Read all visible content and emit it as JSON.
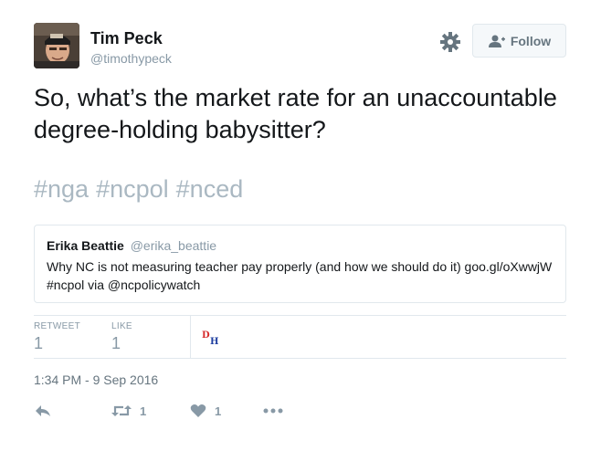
{
  "author": {
    "name": "Tim Peck",
    "handle": "@timothypeck"
  },
  "header": {
    "follow_label": "Follow",
    "settings_icon": "gear-icon",
    "follow_icon": "add-user-icon"
  },
  "tweet": {
    "text": "So, what’s the market rate for an unaccountable degree-holding babysitter?",
    "hashtags": [
      "#nga",
      "#ncpol",
      "#nced"
    ]
  },
  "quoted_tweet": {
    "name": "Erika Beattie",
    "handle": "@erika_beattie",
    "text": "Why NC is not measuring teacher pay properly (and how we should do it) goo.gl/oXwwjW #ncpol via @ncpolicywatch"
  },
  "stats": {
    "retweet_label": "RETWEET",
    "retweet_count": "1",
    "like_label": "LIKE",
    "like_count": "1",
    "liker_logo_text": "DH"
  },
  "timestamp": "1:34 PM - 9 Sep 2016",
  "actions": {
    "reply_icon": "reply-icon",
    "retweet_icon": "retweet-icon",
    "retweet_count": "1",
    "like_icon": "heart-icon",
    "like_count": "1",
    "more_icon": "more-icon"
  },
  "colors": {
    "text": "#14171a",
    "muted": "#8899a6",
    "hashtag": "#aab8c2",
    "border": "#e1e8ed",
    "button_bg": "#f5f8fa"
  }
}
